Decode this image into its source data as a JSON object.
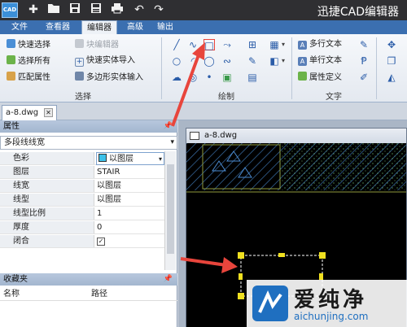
{
  "titlebar": {
    "logo_text": "CAD",
    "app_title": "迅捷CAD编辑器",
    "quick_access_icons": [
      "new-file-icon",
      "open-folder-icon",
      "save-icon",
      "save-as-icon",
      "print-icon",
      "undo-icon",
      "redo-icon"
    ]
  },
  "menubar": {
    "items": [
      {
        "label": "文件",
        "active": false
      },
      {
        "label": "查看器",
        "active": false
      },
      {
        "label": "编辑器",
        "active": true
      },
      {
        "label": "高级",
        "active": false
      },
      {
        "label": "输出",
        "active": false
      }
    ]
  },
  "ribbon": {
    "select_group": {
      "label": "选择",
      "quick_select": "快速选择",
      "block_editor": "块编辑器",
      "select_all": "选择所有",
      "quick_solid_import": "快速实体导入",
      "match_properties": "匹配属性",
      "polygon_solid_input": "多边形实体输入"
    },
    "draw_group": {
      "label": "绘制"
    },
    "text_group": {
      "label": "文字",
      "mtext": "多行文本",
      "single_text": "单行文本",
      "attribute_def": "属性定义"
    }
  },
  "document_tab": {
    "name": "a-8.dwg"
  },
  "properties_panel": {
    "title": "属性",
    "selected_object": "多段线线宽",
    "rows": [
      {
        "key": "色彩",
        "value": "以图层",
        "swatch_color": "#3cc0e8"
      },
      {
        "key": "图层",
        "value": "STAIR"
      },
      {
        "key": "线宽",
        "value": "以图层"
      },
      {
        "key": "线型",
        "value": "以图层"
      },
      {
        "key": "线型比例",
        "value": "1"
      },
      {
        "key": "厚度",
        "value": "0"
      },
      {
        "key": "闭合",
        "value": "✓"
      }
    ]
  },
  "favorites_panel": {
    "title": "收藏夹",
    "col_name": "名称",
    "col_path": "路径"
  },
  "drawing_window": {
    "title": "a-8.dwg"
  },
  "watermark": {
    "brand": "爱纯净",
    "url": "aichunjing.com"
  },
  "colors": {
    "titlebar": "#2f2f32",
    "menubar": "#3b6fb0",
    "annotation_arrow": "#e8453c",
    "grip_point": "#f0e020",
    "hatch_lines": "#3a6fa8"
  }
}
